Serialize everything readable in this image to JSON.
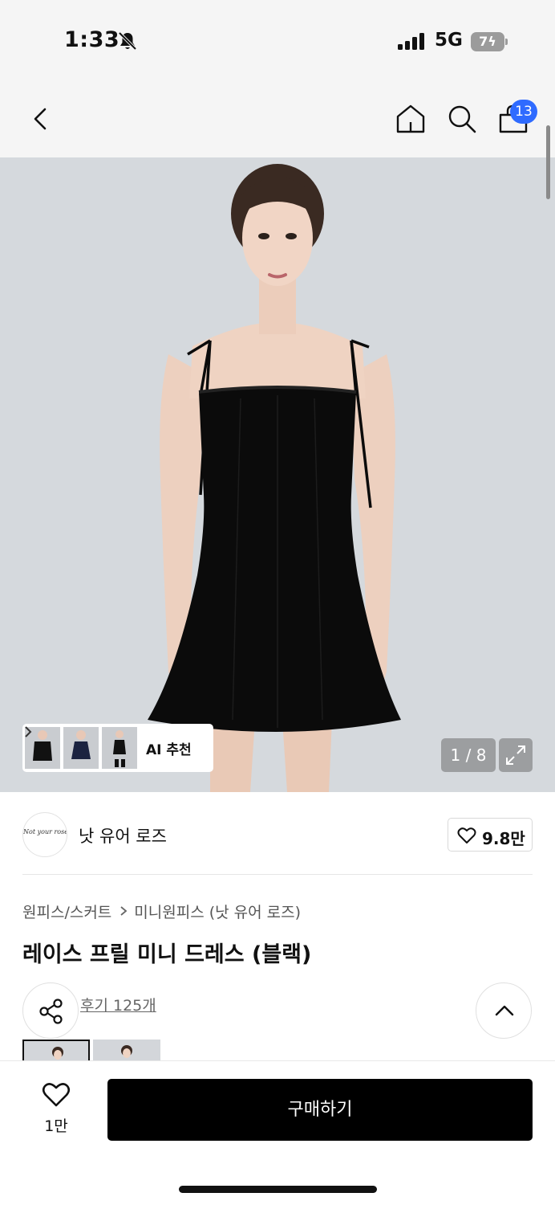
{
  "status_bar": {
    "time": "1:33",
    "network": "5G",
    "battery": "7"
  },
  "nav": {
    "cart_badge": "13"
  },
  "gallery": {
    "ai_recommend_label": "AI 추천",
    "page_counter": "1 / 8"
  },
  "brand": {
    "logo_text": "Not your rose",
    "name": "낫 유어 로즈",
    "like_count": "9.8만"
  },
  "product": {
    "breadcrumb": [
      "원피스/스커트",
      "미니원피스 (낫 유어 로즈)"
    ],
    "title": "레이스 프릴 미니 드레스 (블랙)",
    "review_link": "후기 125개"
  },
  "bottom_bar": {
    "wish_count": "1만",
    "buy_label": "구매하기"
  },
  "colors": {
    "badge": "#2f6bff",
    "buy_button": "#000000",
    "hero_background": "#d5d9dd",
    "dress": "#0b0b0b"
  },
  "icons": [
    "bell-off-icon",
    "signal-icon",
    "battery-icon",
    "back-icon",
    "home-icon",
    "search-icon",
    "cart-icon",
    "chevron-right-icon",
    "expand-icon",
    "heart-icon",
    "share-icon",
    "chevron-up-icon"
  ]
}
